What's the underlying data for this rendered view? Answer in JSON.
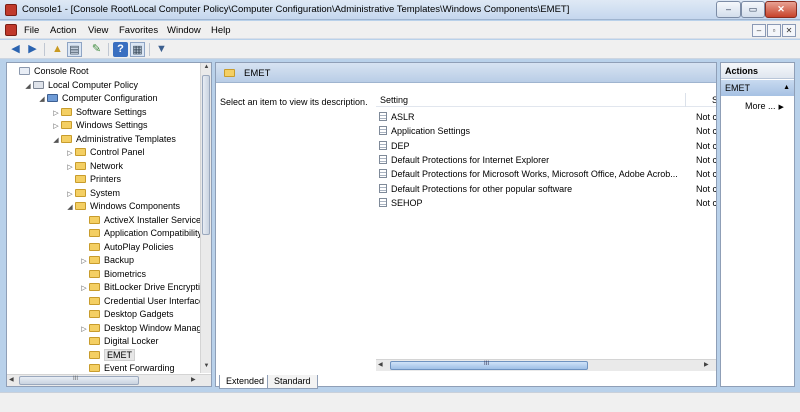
{
  "window": {
    "title": "Console1 - [Console Root\\Local Computer Policy\\Computer Configuration\\Administrative Templates\\Windows Components\\EMET]",
    "min_label": "–",
    "max_label": "▭",
    "close_label": "✕"
  },
  "menu": {
    "items": [
      "File",
      "Action",
      "View",
      "Favorites",
      "Window",
      "Help"
    ],
    "child_controls": [
      "–",
      "▫",
      "✕"
    ]
  },
  "toolbar": {
    "buttons": [
      "back-icon",
      "forward-icon",
      "up-folder-icon",
      "show-hide-tree-icon",
      "export-list-icon",
      "help-icon",
      "properties-icon",
      "filter-icon"
    ]
  },
  "tree": {
    "items": [
      {
        "label": "Console Root",
        "indent": 0,
        "expander": ""
      },
      {
        "label": "Local Computer Policy",
        "indent": 1,
        "expander": "◢"
      },
      {
        "label": "Computer Configuration",
        "indent": 2,
        "expander": "◢"
      },
      {
        "label": "Software Settings",
        "indent": 3,
        "expander": "▷"
      },
      {
        "label": "Windows Settings",
        "indent": 3,
        "expander": "▷"
      },
      {
        "label": "Administrative Templates",
        "indent": 3,
        "expander": "◢"
      },
      {
        "label": "Control Panel",
        "indent": 4,
        "expander": "▷"
      },
      {
        "label": "Network",
        "indent": 4,
        "expander": "▷"
      },
      {
        "label": "Printers",
        "indent": 4,
        "expander": ""
      },
      {
        "label": "System",
        "indent": 4,
        "expander": "▷"
      },
      {
        "label": "Windows Components",
        "indent": 4,
        "expander": "◢"
      },
      {
        "label": "ActiveX Installer Service",
        "indent": 5,
        "expander": ""
      },
      {
        "label": "Application Compatibility",
        "indent": 5,
        "expander": ""
      },
      {
        "label": "AutoPlay Policies",
        "indent": 5,
        "expander": ""
      },
      {
        "label": "Backup",
        "indent": 5,
        "expander": "▷"
      },
      {
        "label": "Biometrics",
        "indent": 5,
        "expander": ""
      },
      {
        "label": "BitLocker Drive Encryption",
        "indent": 5,
        "expander": "▷"
      },
      {
        "label": "Credential User Interface",
        "indent": 5,
        "expander": ""
      },
      {
        "label": "Desktop Gadgets",
        "indent": 5,
        "expander": ""
      },
      {
        "label": "Desktop Window Manager",
        "indent": 5,
        "expander": "▷"
      },
      {
        "label": "Digital Locker",
        "indent": 5,
        "expander": ""
      },
      {
        "label": "EMET",
        "indent": 5,
        "expander": "",
        "selected": true
      },
      {
        "label": "Event Forwarding",
        "indent": 5,
        "expander": ""
      }
    ],
    "hscroll_label": "III"
  },
  "center": {
    "header_title": "EMET",
    "description": "Select an item to view its description.",
    "columns": {
      "setting": "Setting",
      "state": "S"
    },
    "rows": [
      {
        "name": "ASLR",
        "state": "Not co"
      },
      {
        "name": "Application Settings",
        "state": "Not co"
      },
      {
        "name": "DEP",
        "state": "Not co"
      },
      {
        "name": "Default Protections for Internet Explorer",
        "state": "Not co"
      },
      {
        "name": "Default Protections for Microsoft Works, Microsoft Office, Adobe Acrob...",
        "state": "Not co"
      },
      {
        "name": "Default Protections for other popular software",
        "state": "Not co"
      },
      {
        "name": "SEHOP",
        "state": "Not co"
      }
    ],
    "hscroll_label": "III",
    "tabs": [
      "Extended",
      "Standard"
    ]
  },
  "actions": {
    "title": "Actions",
    "section": "EMET",
    "more": "More ..."
  },
  "colors": {
    "accent": "#b9d1ea",
    "folder": "#f4cf63"
  }
}
